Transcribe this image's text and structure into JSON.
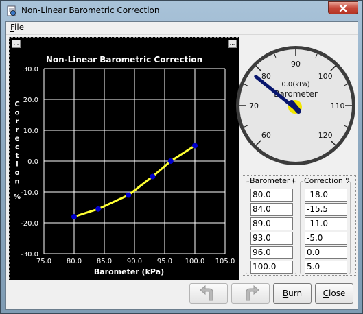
{
  "window": {
    "title": "Non-Linear Barometric Correction"
  },
  "menu": {
    "file_u": "F",
    "file_rest": "ile"
  },
  "chart": {
    "title": "Non-Linear Barometric Correction",
    "xlabel": "Barometer (kPa)",
    "ylabel_letters": [
      "C",
      "o",
      "r",
      "r",
      "e",
      "c",
      "t",
      "i",
      "o",
      "n"
    ],
    "ylabel_unit": "%",
    "x_ticks": [
      "75.0",
      "80.0",
      "85.0",
      "90.0",
      "95.0",
      "100.0",
      "105.0"
    ],
    "y_ticks": [
      "30.0",
      "20.0",
      "10.0",
      "0.0",
      "-10.0",
      "-20.0",
      "-30.0"
    ],
    "corner_button": "..."
  },
  "chart_data": {
    "type": "line",
    "title": "Non-Linear Barometric Correction",
    "xlabel": "Barometer (kPa)",
    "ylabel": "Correction %",
    "xlim": [
      75,
      105
    ],
    "ylim": [
      -30,
      30
    ],
    "x": [
      80.0,
      84.0,
      89.0,
      93.0,
      96.0,
      100.0
    ],
    "series": [
      {
        "values": [
          -18.0,
          -15.5,
          -11.0,
          -5.0,
          0.0,
          5.0
        ]
      }
    ],
    "colors": {
      "line": "#ffff33",
      "points": "#0000cc",
      "grid": "#ffffff",
      "background": "#000000"
    },
    "grid": true
  },
  "gauge": {
    "value_text": "0.0(kPa)",
    "label": "Barometer",
    "value": 0.0,
    "min": 60,
    "max": 120,
    "ticks": [
      "60",
      "70",
      "80",
      "90",
      "100",
      "110",
      "120"
    ]
  },
  "table": {
    "col1_header": "Barometer (kPa)",
    "col2_header": "Correction %",
    "barometer": [
      "80.0",
      "84.0",
      "89.0",
      "93.0",
      "96.0",
      "100.0"
    ],
    "correction": [
      "-18.0",
      "-15.5",
      "-11.0",
      "-5.0",
      "0.0",
      "5.0"
    ]
  },
  "buttons": {
    "burn_u": "B",
    "burn_rest": "urn",
    "close_u": "C",
    "close_rest": "lose",
    "undo_icon": "undo-arrow-icon",
    "redo_icon": "redo-arrow-icon"
  }
}
